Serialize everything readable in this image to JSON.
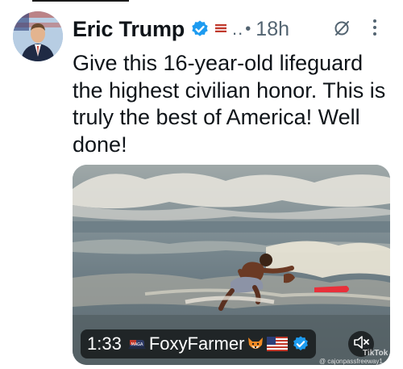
{
  "tweet": {
    "author_name": "Eric Trump",
    "timestamp": "18h",
    "truncation": "..",
    "separator": "•",
    "text": "Give this 16-year-old lifeguard the highest civilian honor.  This is truly the best of America! Well done!"
  },
  "video": {
    "duration": "1:33",
    "handle": "FoxyFarmer",
    "watermark_top": "TikTok",
    "watermark_handle": "@ cajonpassfreeway1"
  },
  "icons": {
    "verified": "verified-badge-icon",
    "flag": "flag-icon",
    "grok": "grok-icon",
    "more": "more-options-icon",
    "mute": "mute-icon"
  },
  "colors": {
    "verified_blue": "#1d9bf0",
    "secondary_text": "#536471",
    "primary_text": "#0f1419",
    "surfboard_red": "#e8303a"
  }
}
